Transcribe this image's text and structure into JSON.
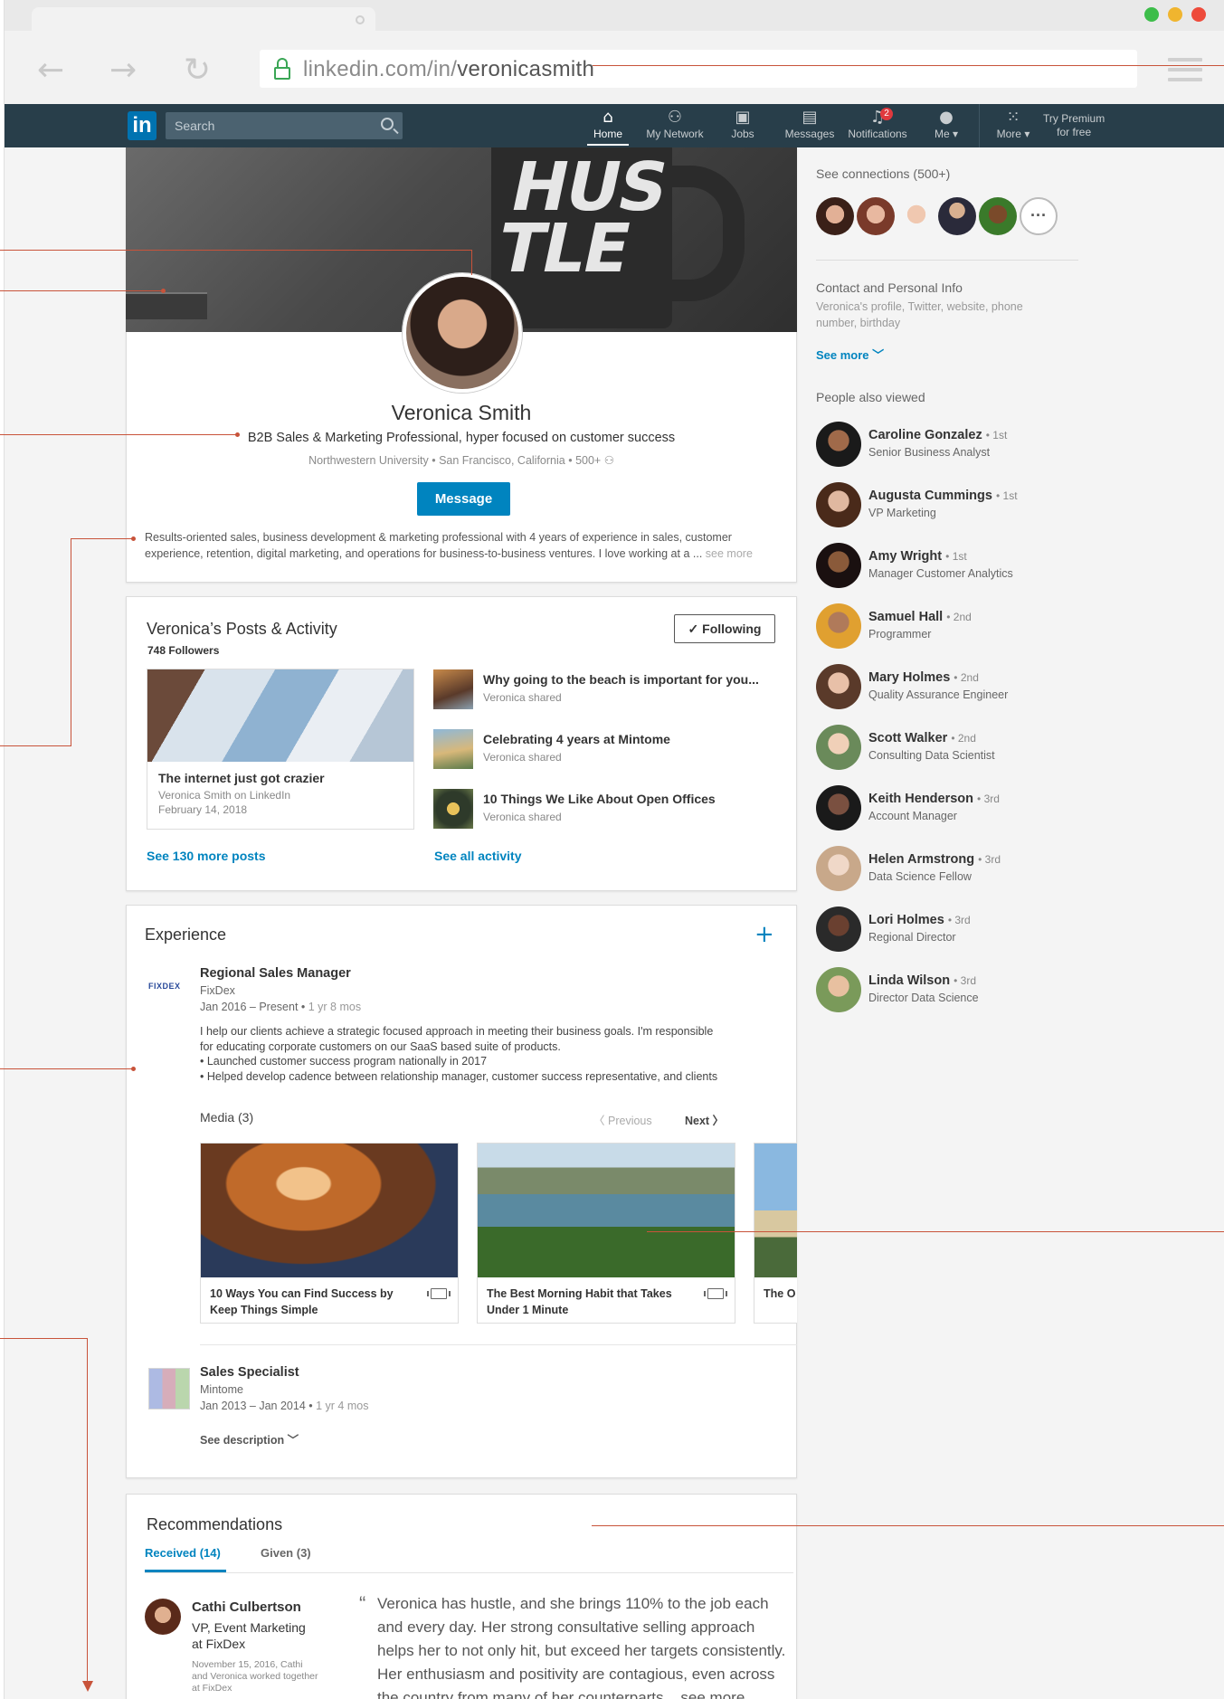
{
  "browser": {
    "url_prefix": "linkedin.com/in/",
    "url_path": "veronicasmith",
    "back": "←",
    "forward": "→",
    "reload": "↻",
    "traffic_lights": [
      "#3dbd4a",
      "#f0b52f",
      "#ee4b3b"
    ]
  },
  "nav": {
    "logo": "in",
    "search_placeholder": "Search",
    "items": [
      {
        "label": "Home",
        "icon": "home-icon"
      },
      {
        "label": "My Network",
        "icon": "network-icon"
      },
      {
        "label": "Jobs",
        "icon": "briefcase-icon"
      },
      {
        "label": "Messages",
        "icon": "messages-icon"
      },
      {
        "label": "Notifications",
        "icon": "bell-icon",
        "badge": "2"
      },
      {
        "label": "Me ▾",
        "icon": "avatar-icon"
      },
      {
        "label": "More ▾",
        "icon": "grid-icon"
      }
    ],
    "premium_line1": "Try Premium",
    "premium_line2": "for free"
  },
  "profile": {
    "cover_text": "HUS\nTLE",
    "name": "Veronica Smith",
    "headline": "B2B Sales & Marketing Professional, hyper focused on customer success",
    "school": "Northwestern University",
    "location": "San Francisco, California",
    "connections": "500+",
    "message_label": "Message",
    "summary": "Results-oriented sales, business development & marketing professional with 4 years of experience in sales, customer experience, retention, digital marketing, and operations for business-to-business ventures. I love working at a ...",
    "summary_more": "see more"
  },
  "activity": {
    "title": "Veronica’s Posts & Activity",
    "followers": "748 Followers",
    "following_label": "✓ Following",
    "featured": {
      "title": "The internet just got crazier",
      "byline": "Veronica Smith on LinkedIn",
      "date": "February 14, 2018"
    },
    "items": [
      {
        "title": "Why going to the beach is important for you...",
        "sub": "Veronica shared"
      },
      {
        "title": "Celebrating 4 years at Mintome",
        "sub": "Veronica shared"
      },
      {
        "title": "10 Things We Like About Open Offices",
        "sub": "Veronica shared"
      }
    ],
    "see_posts": "See 130 more posts",
    "see_activity": "See all activity"
  },
  "experience": {
    "title": "Experience",
    "add": "+",
    "jobs": [
      {
        "logo_text": "FIXDEX",
        "title": "Regional Sales Manager",
        "company": "FixDex",
        "dates": "Jan 2016 – Present",
        "duration": "1 yr 8 mos",
        "description": [
          "I help our clients achieve a strategic focused approach in meeting their business goals. I'm responsible",
          "for educating corporate customers on our SaaS based suite of products.",
          "• Launched customer success program nationally in 2017",
          "• Helped develop cadence between relationship manager, customer success representative, and clients"
        ]
      },
      {
        "title": "Sales Specialist",
        "company": "Mintome",
        "dates": "Jan 2013 – Jan 2014",
        "duration": "1 yr 4 mos",
        "see_description": "See description"
      }
    ],
    "media_label": "Media (3)",
    "previous": "Previous",
    "next": "Next",
    "media": [
      {
        "title": "10 Ways You can Find Success by Keep Things Simple"
      },
      {
        "title": "The Best Morning Habit that Takes Under 1 Minute"
      },
      {
        "title": "The O Every"
      }
    ]
  },
  "recommendations": {
    "title": "Recommendations",
    "tab_received": "Received (14)",
    "tab_given": "Given (3)",
    "name": "Cathi Culbertson",
    "role_line1": "VP, Event Marketing",
    "role_line2": "at FixDex",
    "meta": [
      "November 15, 2016, Cathi",
      "and Veronica worked together",
      "at FixDex"
    ],
    "quote_mark": "“",
    "quote_lines": [
      "Veronica has hustle, and she brings 110% to the job each",
      "and every day. Her strong consultative selling approach",
      "helps her to not only hit, but exceed her targets consistently.",
      "Her enthusiasm and positivity are contagious, even across",
      "the country from many of her counterparts... see more"
    ]
  },
  "rail": {
    "connections_title": "See connections (500+)",
    "more_dots": "···",
    "contact_title": "Contact and Personal Info",
    "contact_sub": "Veronica's profile, Twitter, website, phone number, birthday",
    "see_more": "See more",
    "also_viewed_title": "People also viewed",
    "people": [
      {
        "name": "Caroline Gonzalez",
        "degree": "1st",
        "title": "Senior Business Analyst"
      },
      {
        "name": "Augusta Cummings",
        "degree": "1st",
        "title": "VP Marketing"
      },
      {
        "name": "Amy Wright",
        "degree": "1st",
        "title": "Manager Customer Analytics"
      },
      {
        "name": "Samuel Hall",
        "degree": "2nd",
        "title": "Programmer"
      },
      {
        "name": "Mary Holmes",
        "degree": "2nd",
        "title": "Quality Assurance Engineer"
      },
      {
        "name": "Scott Walker",
        "degree": "2nd",
        "title": "Consulting Data Scientist"
      },
      {
        "name": "Keith Henderson",
        "degree": "3rd",
        "title": "Account Manager"
      },
      {
        "name": "Helen Armstrong",
        "degree": "3rd",
        "title": "Data Science Fellow"
      },
      {
        "name": "Lori Holmes",
        "degree": "3rd",
        "title": "Regional Director"
      },
      {
        "name": "Linda Wilson",
        "degree": "3rd",
        "title": "Director Data Science"
      }
    ]
  }
}
